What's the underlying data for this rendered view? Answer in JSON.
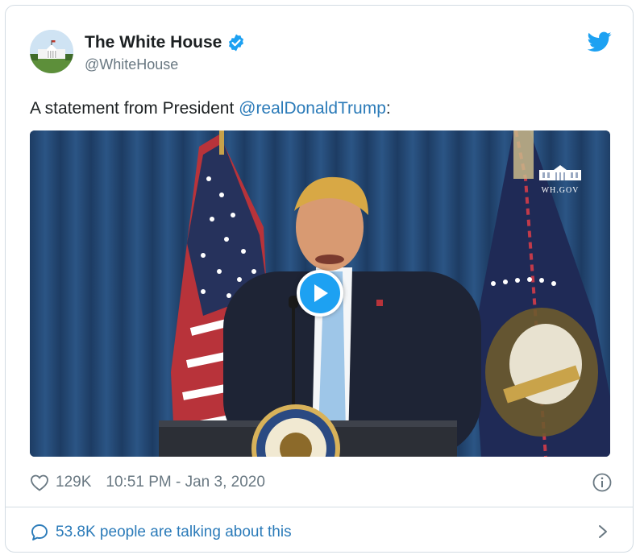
{
  "author": {
    "name": "The White House",
    "handle": "@WhiteHouse",
    "verified": true,
    "avatar_icon": "white-house-avatar"
  },
  "tweet": {
    "text_prefix": "A statement from President ",
    "mention": "@realDonaldTrump",
    "text_suffix": ":"
  },
  "media": {
    "type": "video",
    "watermark": "WH.GOV",
    "play_icon": "play-icon"
  },
  "meta": {
    "likes": "129K",
    "timestamp": "10:51 PM - Jan 3, 2020"
  },
  "footer": {
    "conversation": "53.8K people are talking about this"
  },
  "colors": {
    "link": "#2b7bb9",
    "twitter_blue": "#1da1f2",
    "muted": "#697882",
    "border": "#d3dce3"
  }
}
